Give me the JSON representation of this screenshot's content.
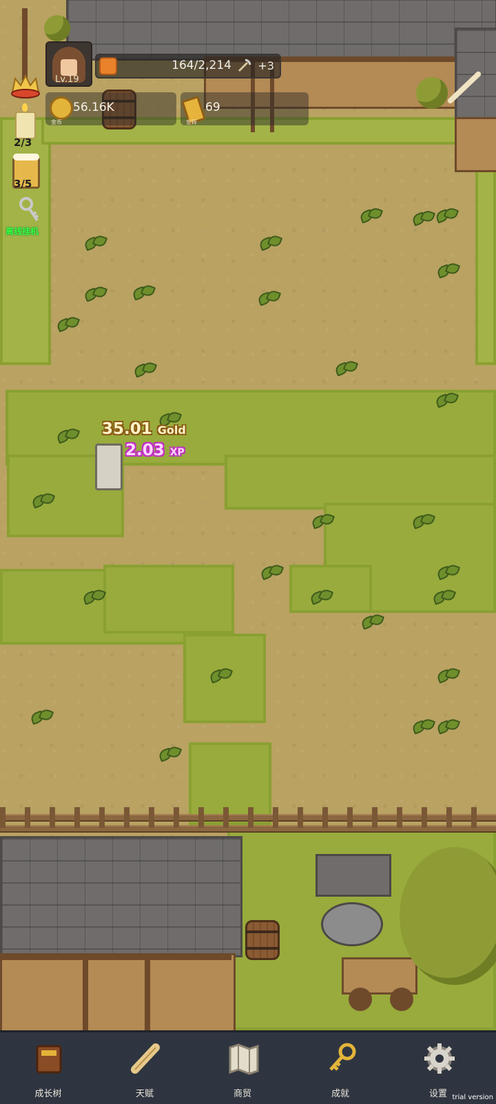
{
  "hud": {
    "level": "Lv.19",
    "xp_current_total": "164/2,214",
    "xp_bonus": "+3",
    "gold_value": "56.16K",
    "gold_label": "金币",
    "goldbar_value": "69",
    "goldbar_label": "金砖"
  },
  "side": {
    "candle_count": "2/3",
    "beer_count": "3/5",
    "idle_label": "离线挂机"
  },
  "floating": {
    "gold_amount": "35.01",
    "gold_unit": "Gold",
    "xp_amount": "2.03",
    "xp_unit": "XP"
  },
  "nav": {
    "items": [
      {
        "label": "成长树",
        "icon": "book-icon"
      },
      {
        "label": "天赋",
        "icon": "scroll-icon"
      },
      {
        "label": "商贸",
        "icon": "map-icon"
      },
      {
        "label": "成就",
        "icon": "key-icon"
      },
      {
        "label": "设置",
        "icon": "gear-icon"
      }
    ],
    "watermark": "trial version"
  },
  "colors": {
    "grass": "#98ab3c",
    "dirt": "#b9a262",
    "nav_bg": "#2f3540",
    "gold_text": "#fff3c6",
    "xp_text": "#ffd5ff",
    "idle_green": "#39ff3b"
  }
}
